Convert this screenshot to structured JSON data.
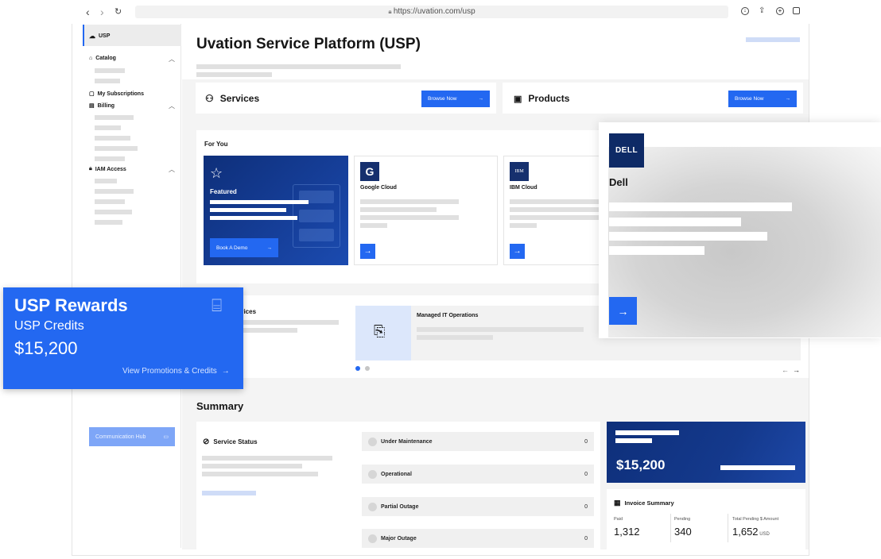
{
  "browser": {
    "url": "https://uvation.com/usp"
  },
  "sidebar": {
    "active": "USP",
    "items": [
      {
        "label": "Catalog"
      },
      {
        "label": "My Subscriptions"
      },
      {
        "label": "Billing"
      },
      {
        "label": "IAM Access"
      }
    ],
    "communication_hub": "Communication Hub"
  },
  "header": {
    "title": "Uvation Service Platform (USP)"
  },
  "services_card": {
    "title": "Services",
    "button": "Browse Now"
  },
  "products_card": {
    "title": "Products",
    "button": "Browse Now"
  },
  "for_you": {
    "title": "For You",
    "featured": {
      "label": "Featured",
      "button": "Book A Demo"
    },
    "cards": [
      {
        "name": "Google Cloud",
        "logo": "G"
      },
      {
        "name": "IBM Cloud",
        "logo": "IBM"
      }
    ]
  },
  "dell": {
    "name": "Dell",
    "logo": "DELL"
  },
  "managed": {
    "partial_title": "vices",
    "title": "Managed IT Operations"
  },
  "rewards": {
    "title": "USP Rewards",
    "subtitle": "USP Credits",
    "amount": "$15,200",
    "link": "View Promotions & Credits"
  },
  "summary": {
    "title": "Summary",
    "service_status": "Service Status",
    "statuses": [
      {
        "label": "Under Maintenance",
        "count": "0"
      },
      {
        "label": "Operational",
        "count": "0"
      },
      {
        "label": "Partial Outage",
        "count": "0"
      },
      {
        "label": "Major Outage",
        "count": "0"
      }
    ],
    "balance": "$15,200",
    "invoice": {
      "title": "Invoice Summary",
      "paid_label": "Paid",
      "paid": "1,312",
      "pending_label": "Pending",
      "pending": "340",
      "total_label": "Total Pending $ Amount",
      "total": "1,652",
      "currency": "USD"
    }
  },
  "colors": {
    "accent": "#2368f1",
    "navy": "#0e2f7a",
    "panel": "#f4f4f4"
  }
}
